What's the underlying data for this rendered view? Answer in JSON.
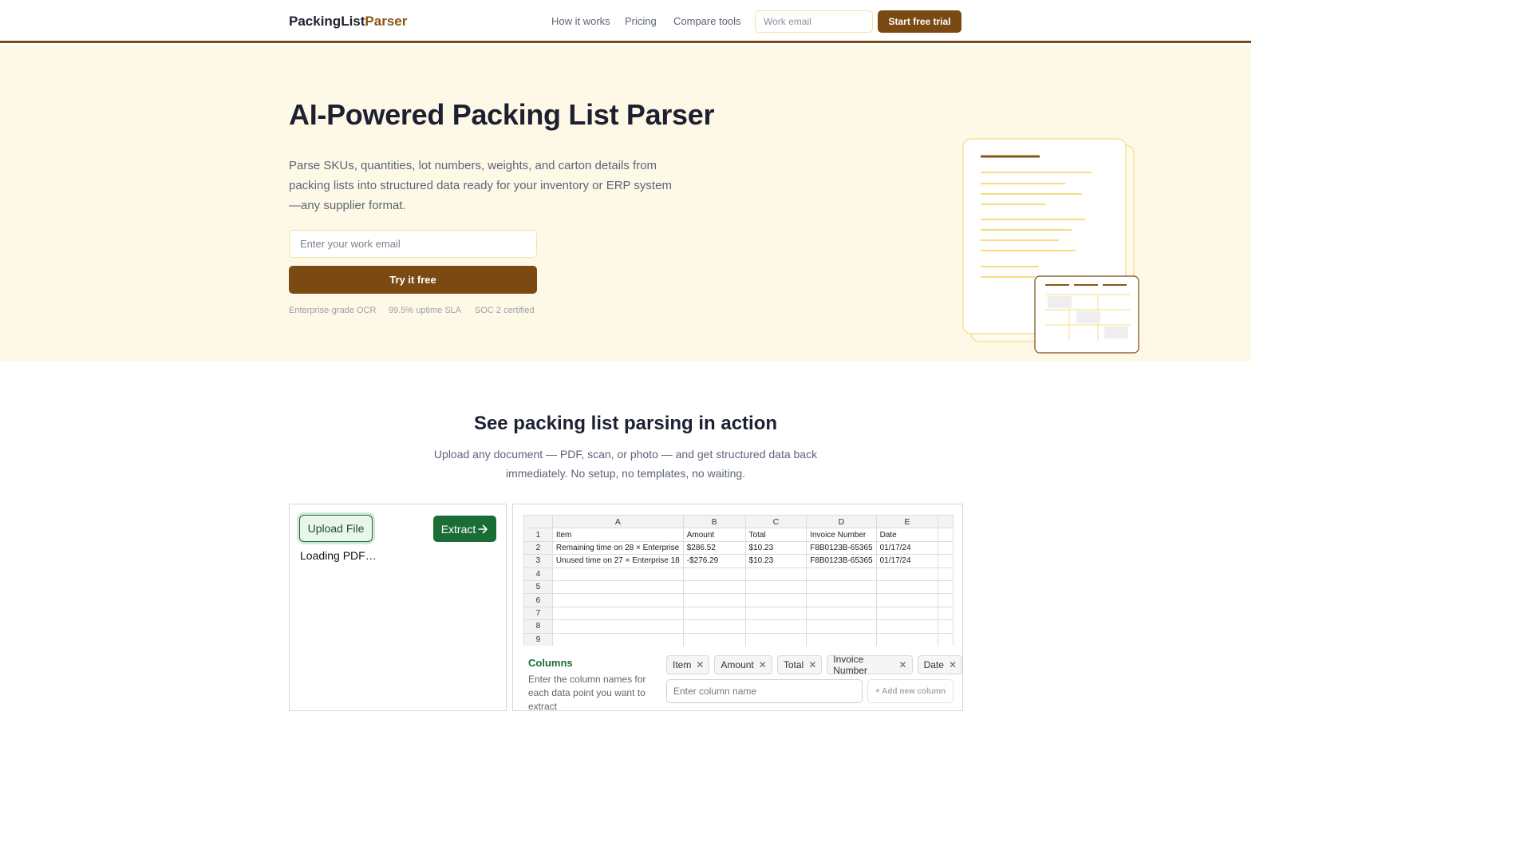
{
  "nav": {
    "logo_main": "PackingList",
    "logo_accent": "Parser",
    "links": [
      "How it works",
      "Pricing",
      "Compare tools"
    ],
    "email_placeholder": "Work email",
    "cta": "Start free trial"
  },
  "hero": {
    "title": "AI-Powered Packing List Parser",
    "lead": "Parse SKUs, quantities, lot numbers, weights, and carton details from packing lists into structured data ready for your inventory or ERP system—any supplier format.",
    "email_placeholder": "Enter your work email",
    "cta": "Try it free",
    "trust": [
      "Enterprise-grade OCR",
      "99.5% uptime SLA",
      "SOC 2 certified"
    ]
  },
  "demo": {
    "title": "See packing list parsing in action",
    "subtitle": "Upload any document — PDF, scan, or photo — and get structured data back immediately. No setup, no templates, no waiting.",
    "upload_label": "Upload File",
    "extract_label": "Extract",
    "loading_text": "Loading PDF…",
    "sheet": {
      "column_letters": [
        "A",
        "B",
        "C",
        "D",
        "E"
      ],
      "row_numbers": [
        "1",
        "2",
        "3",
        "4",
        "5",
        "6",
        "7",
        "8",
        "9"
      ],
      "rows": [
        [
          "Item",
          "Amount",
          "Total",
          "Invoice Number",
          "Date"
        ],
        [
          "Remaining time on 28 × Enterprise",
          "$286.52",
          "$10.23",
          "F8B0123B-65365",
          "01/17/24"
        ],
        [
          "Unused time on 27 × Enterprise 18",
          "-$276.29",
          "$10.23",
          "F8B0123B-65365",
          "01/17/24"
        ]
      ]
    },
    "columns_title": "Columns",
    "columns_help": "Enter the column names for each data point you want to extract",
    "chips": [
      "Item",
      "Amount",
      "Total",
      "Invoice Number",
      "Date"
    ],
    "column_placeholder": "Enter column name",
    "add_column_label": "+ Add new column"
  },
  "colors": {
    "brand": "#7b4a12",
    "hero_bg": "#fef9e6",
    "green": "#1a6d35"
  }
}
